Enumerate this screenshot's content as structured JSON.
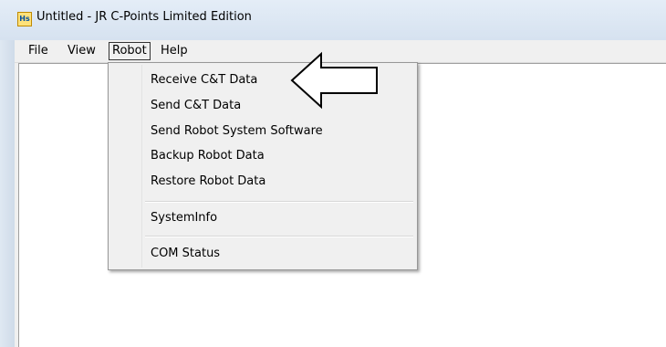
{
  "window": {
    "title": "Untitled - JR C-Points Limited Edition",
    "app_icon_text": "Hs"
  },
  "menubar": {
    "items": [
      {
        "label": "File"
      },
      {
        "label": "View"
      },
      {
        "label": "Robot"
      },
      {
        "label": "Help"
      }
    ],
    "open_menu": "Robot"
  },
  "robot_menu": {
    "items": [
      {
        "label": "Receive C&T Data"
      },
      {
        "label": "Send C&T Data"
      },
      {
        "label": "Send Robot System Software"
      },
      {
        "label": "Backup Robot Data"
      },
      {
        "label": "Restore Robot Data"
      },
      {
        "label": "SystemInfo"
      },
      {
        "label": "COM Status"
      }
    ]
  },
  "colors": {
    "menu_background": "#f0f0f0",
    "title_bar": "#d6e2f0",
    "arrow_fill": "#ffffff",
    "arrow_stroke": "#000000"
  }
}
